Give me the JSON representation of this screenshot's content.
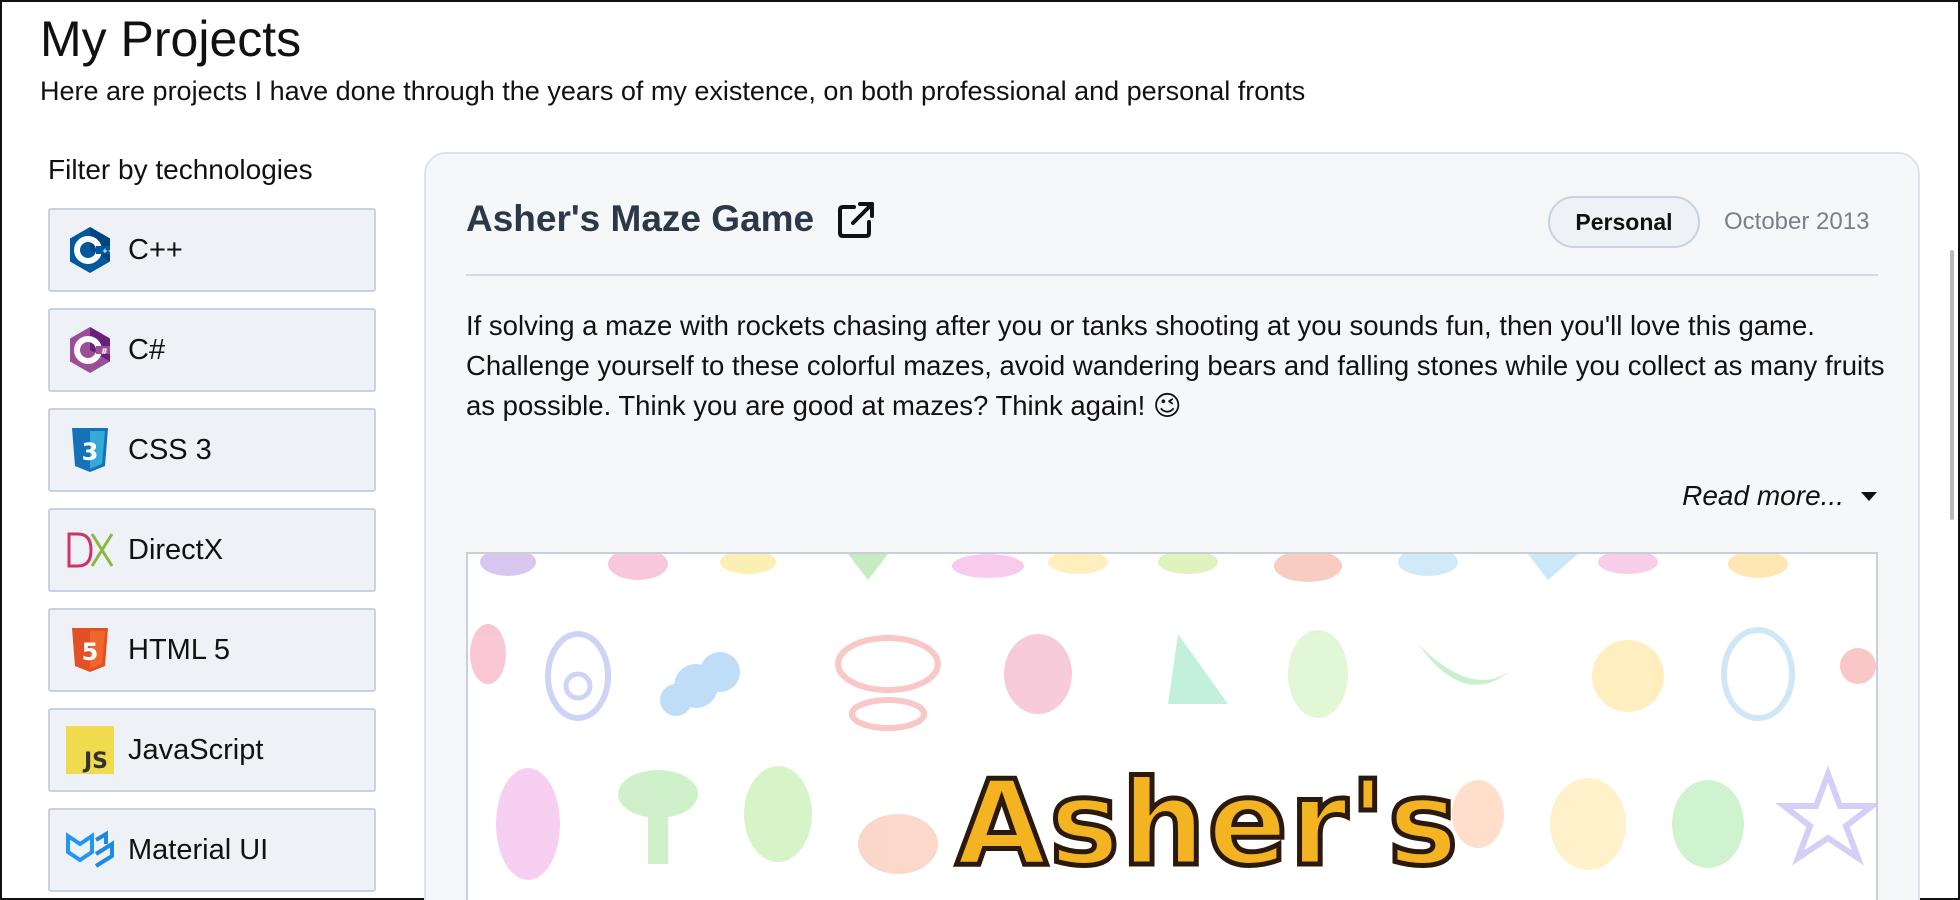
{
  "page": {
    "title": "My Projects",
    "subtitle": "Here are projects I have done through the years of my existence, on both professional and personal fronts"
  },
  "filters": {
    "heading": "Filter by technologies",
    "items": [
      {
        "label": "C++",
        "icon": "cplusplus-icon"
      },
      {
        "label": "C#",
        "icon": "csharp-icon"
      },
      {
        "label": "CSS 3",
        "icon": "css3-icon"
      },
      {
        "label": "DirectX",
        "icon": "directx-icon"
      },
      {
        "label": "HTML 5",
        "icon": "html5-icon"
      },
      {
        "label": "JavaScript",
        "icon": "javascript-icon"
      },
      {
        "label": "Material UI",
        "icon": "material-ui-icon"
      }
    ]
  },
  "project": {
    "title": "Asher's Maze Game",
    "category": "Personal",
    "date": "October 2013",
    "description": "If solving a maze with rockets chasing after you or tanks shooting at you sounds fun, then you'll love this game. Challenge yourself to these colorful mazes, avoid wandering bears and falling stones while you collect as many fruits as possible. Think you are good at mazes? Think again! 😉",
    "read_more": "Read more...",
    "image_logo_text": "Asher's"
  },
  "colors": {
    "card_background": "#f6f7f9",
    "filter_background": "#eef1f6",
    "title_color": "#2c3748",
    "date_color": "#7a808a"
  }
}
